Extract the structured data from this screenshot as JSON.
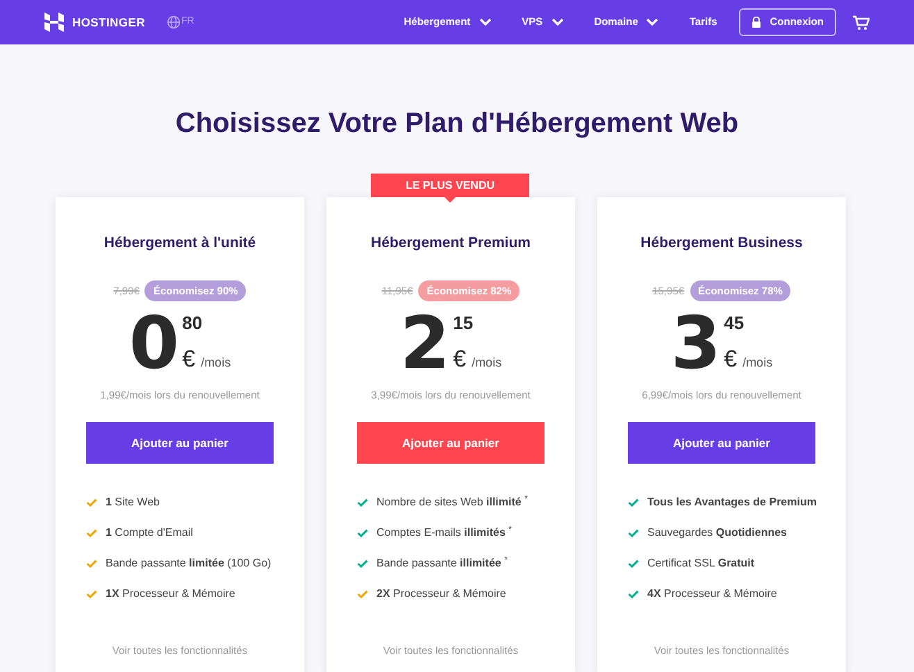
{
  "nav": {
    "brand": "HOSTINGER",
    "language": "FR",
    "menu": [
      {
        "label": "Hébergement",
        "dropdown": true
      },
      {
        "label": "VPS",
        "dropdown": true
      },
      {
        "label": "Domaine",
        "dropdown": true
      },
      {
        "label": "Tarifs",
        "dropdown": false
      }
    ],
    "login": "Connexion"
  },
  "title": "Choisissez Votre Plan d'Hébergement Web",
  "plans": [
    {
      "name": "Hébergement à l'unité",
      "featured": false,
      "old_price": "7,99€",
      "saving": "Économisez 90%",
      "price_int": "0",
      "price_dec": "80",
      "currency": "€",
      "period": "/mois",
      "renewal": "1,99€/mois lors du renouvellement",
      "button": "Ajouter au panier",
      "features": [
        {
          "text": "**1** Site Web",
          "color": "#f0a500"
        },
        {
          "text": "**1** Compte d'Email",
          "color": "#f0a500"
        },
        {
          "text": "Bande passante **limitée** (100 Go)",
          "color": "#f0a500"
        },
        {
          "text": "**1X** Processeur & Mémoire",
          "color": "#f0a500"
        }
      ],
      "more": "Voir toutes les fonctionnalités"
    },
    {
      "name": "Hébergement Premium",
      "featured": true,
      "ribbon": "LE PLUS VENDU",
      "old_price": "11,95€",
      "saving": "Économisez 82%",
      "price_int": "2",
      "price_dec": "15",
      "currency": "€",
      "period": "/mois",
      "renewal": "3,99€/mois lors du renouvellement",
      "button": "Ajouter au panier",
      "features": [
        {
          "text": "Nombre de sites Web **illimité** $^{*}$",
          "color": "#00b090"
        },
        {
          "text": "Comptes E-mails **illimités** $^{*}$",
          "color": "#00b090"
        },
        {
          "text": "Bande passante **illimitée** $^{*}$",
          "color": "#00b090"
        },
        {
          "text": "**2X** Processeur & Mémoire",
          "color": "#f0a500"
        }
      ],
      "more": "Voir toutes les fonctionnalités"
    },
    {
      "name": "Hébergement Business",
      "featured": false,
      "old_price": "15,95€",
      "saving": "Économisez 78%",
      "price_int": "3",
      "price_dec": "45",
      "currency": "€",
      "period": "/mois",
      "renewal": "6,99€/mois lors du renouvellement",
      "button": "Ajouter au panier",
      "features": [
        {
          "text": "**Tous les Avantages de Premium**",
          "color": "#00b090"
        },
        {
          "text": "Sauvegardes **Quotidiennes**",
          "color": "#00b090"
        },
        {
          "text": "Certificat SSL **Gratuit**",
          "color": "#00b090"
        },
        {
          "text": "**4X** Processeur & Mémoire",
          "color": "#00b090"
        }
      ],
      "more": "Voir toutes les fonctionnalités"
    }
  ]
}
